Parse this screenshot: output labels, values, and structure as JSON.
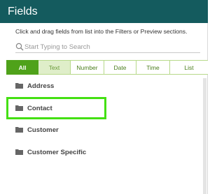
{
  "panel": {
    "title": "Fields",
    "instructions": "Click and drag fields from list into the Filters or Preview sections.",
    "search": {
      "placeholder": "Start Typing to Search",
      "value": ""
    },
    "tabs": [
      {
        "label": "All",
        "state": "selected"
      },
      {
        "label": "Text",
        "state": "active"
      },
      {
        "label": "Number"
      },
      {
        "label": "Date"
      },
      {
        "label": "Time"
      },
      {
        "label": "List"
      }
    ],
    "folders": [
      {
        "label": "Address",
        "icon": "folder-icon"
      },
      {
        "label": "Contact",
        "icon": "folder-icon",
        "highlighted": true
      },
      {
        "label": "Customer",
        "icon": "folder-icon"
      },
      {
        "label": "Customer Specific",
        "icon": "folder-icon"
      }
    ]
  },
  "colors": {
    "header_bg": "#145b5e",
    "tab_selected": "#4fa21a",
    "tab_active": "#dfeec9",
    "highlight_box": "#44e012"
  }
}
